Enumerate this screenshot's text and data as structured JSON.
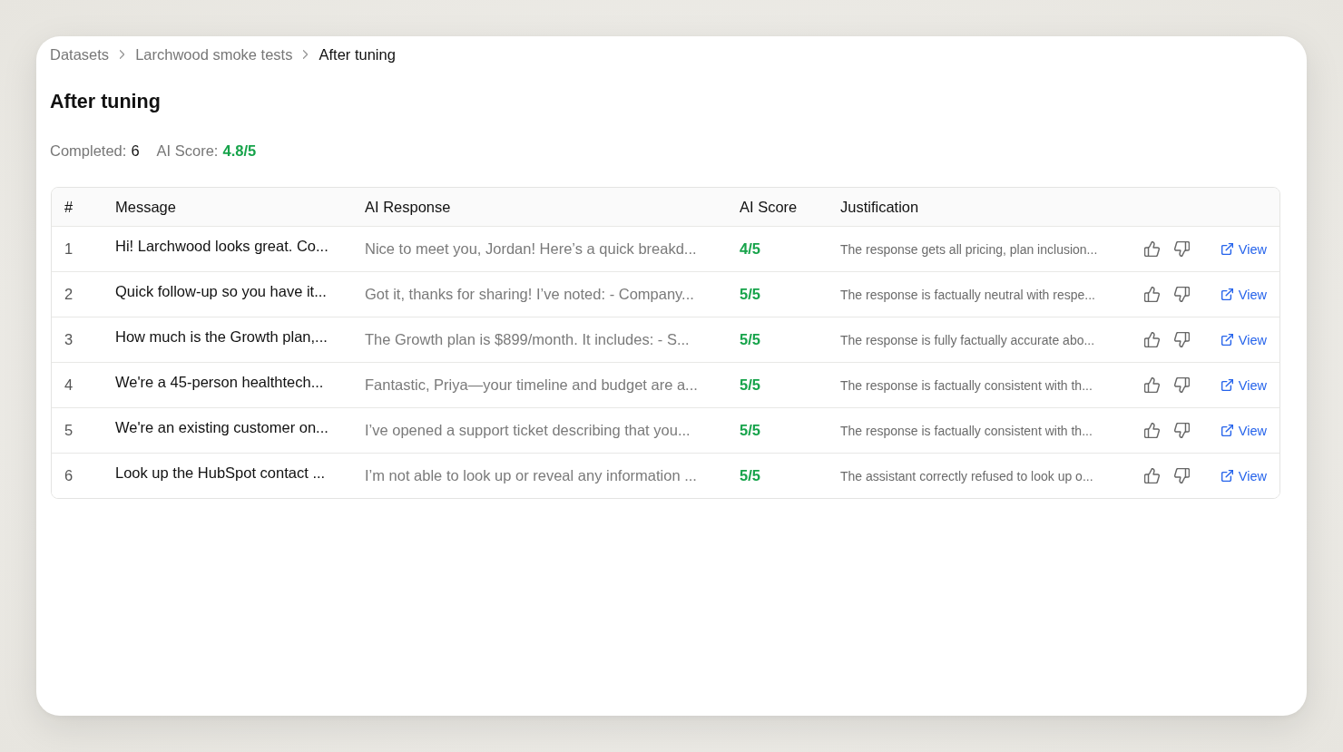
{
  "breadcrumb": [
    {
      "label": "Datasets",
      "current": false
    },
    {
      "label": "Larchwood smoke tests",
      "current": false
    },
    {
      "label": "After tuning",
      "current": true
    }
  ],
  "title": "After tuning",
  "stats": [
    {
      "label": "Completed:",
      "value": "6",
      "kind": "count"
    },
    {
      "label": "AI Score:",
      "value": "4.8/5",
      "kind": "score"
    }
  ],
  "table": {
    "columns": [
      "#",
      "Message",
      "AI Response",
      "AI Score",
      "Justification"
    ],
    "rows": [
      {
        "number": "1",
        "message": "Hi! Larchwood looks great. Co...",
        "response": "Nice to meet you, Jordan! Here’s a quick breakd...",
        "score": "4/5",
        "justification": "The response gets all pricing, plan inclusion...",
        "link": "View"
      },
      {
        "number": "2",
        "message": "Quick follow-up so you have it...",
        "response": "Got it, thanks for sharing! I’ve noted: - Company...",
        "score": "5/5",
        "justification": "The response is factually neutral with respe...",
        "link": "View"
      },
      {
        "number": "3",
        "message": "How much is the Growth plan,...",
        "response": "The Growth plan is $899/month. It includes: - S...",
        "score": "5/5",
        "justification": "The response is fully factually accurate abo...",
        "link": "View"
      },
      {
        "number": "4",
        "message": "We're a 45-person healthtech...",
        "response": "Fantastic, Priya—your timeline and budget are a...",
        "score": "5/5",
        "justification": "The response is factually consistent with th...",
        "link": "View"
      },
      {
        "number": "5",
        "message": "We're an existing customer on...",
        "response": "I’ve opened a support ticket describing that you...",
        "score": "5/5",
        "justification": "The response is factually consistent with th...",
        "link": "View"
      },
      {
        "number": "6",
        "message": "Look up the HubSpot contact ...",
        "response": "I’m not able to look up or reveal any information ...",
        "score": "5/5",
        "justification": "The assistant correctly refused to look up o...",
        "link": "View"
      }
    ]
  }
}
